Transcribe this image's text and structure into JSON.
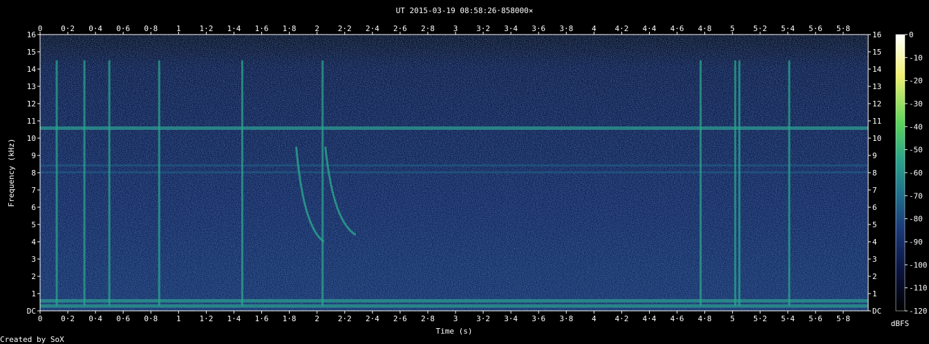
{
  "chart_data": {
    "type": "heatmap",
    "title": "UT 2015-03-19 08:58:26·858000×",
    "xlabel": "Time (s)",
    "ylabel": "Frequency (kHz)",
    "xlim": [
      0,
      5.98
    ],
    "ylim": [
      0,
      16
    ],
    "x_ticks": [
      "0",
      "0·2",
      "0·4",
      "0·6",
      "0·8",
      "1",
      "1·2",
      "1·4",
      "1·6",
      "1·8",
      "2",
      "2·2",
      "2·4",
      "2·6",
      "2·8",
      "3",
      "3·2",
      "3·4",
      "3·6",
      "3·8",
      "4",
      "4·2",
      "4·4",
      "4·6",
      "4·8",
      "5",
      "5·2",
      "5·4",
      "5·6",
      "5·8"
    ],
    "x_tick_values": [
      0,
      0.2,
      0.4,
      0.6,
      0.8,
      1,
      1.2,
      1.4,
      1.6,
      1.8,
      2,
      2.2,
      2.4,
      2.6,
      2.8,
      3,
      3.2,
      3.4,
      3.6,
      3.8,
      4,
      4.2,
      4.4,
      4.6,
      4.8,
      5,
      5.2,
      5.4,
      5.6,
      5.8
    ],
    "y_ticks": [
      "DC",
      "1",
      "2",
      "3",
      "4",
      "5",
      "6",
      "7",
      "8",
      "9",
      "10",
      "11",
      "12",
      "13",
      "14",
      "15",
      "16"
    ],
    "y_tick_values": [
      0,
      1,
      2,
      3,
      4,
      5,
      6,
      7,
      8,
      9,
      10,
      11,
      12,
      13,
      14,
      15,
      16
    ],
    "colorbar": {
      "label": "dBFS",
      "ticks": [
        "0",
        "-10",
        "-20",
        "-30",
        "-40",
        "-50",
        "-60",
        "-70",
        "-80",
        "-90",
        "-100",
        "-110",
        "-120"
      ],
      "tick_values": [
        0,
        -10,
        -20,
        -30,
        -40,
        -50,
        -60,
        -70,
        -80,
        -90,
        -100,
        -110,
        -120
      ],
      "range": [
        -120,
        0
      ],
      "colors": [
        "#000000",
        "#0a1440",
        "#1a3a7a",
        "#1f6f8a",
        "#2aa58c",
        "#5bd45a",
        "#f0f070",
        "#ffffff"
      ]
    },
    "features": {
      "horizontal_lines_khz": [
        10.6,
        8.4,
        8.0,
        0.6,
        0.3
      ],
      "vertical_bursts_s": [
        0.12,
        0.32,
        0.5,
        0.86,
        1.46,
        2.04,
        4.77,
        5.02,
        5.05,
        5.41
      ],
      "whistler_tones": [
        {
          "start_s": 1.85,
          "end_s": 2.05,
          "start_khz": 9.5,
          "end_khz": 4.0
        },
        {
          "start_s": 2.06,
          "end_s": 2.28,
          "start_khz": 9.5,
          "end_khz": 4.4
        }
      ]
    },
    "grid": false,
    "legend": "colorbar-right"
  },
  "footer": {
    "credit": "Created by SoX"
  }
}
